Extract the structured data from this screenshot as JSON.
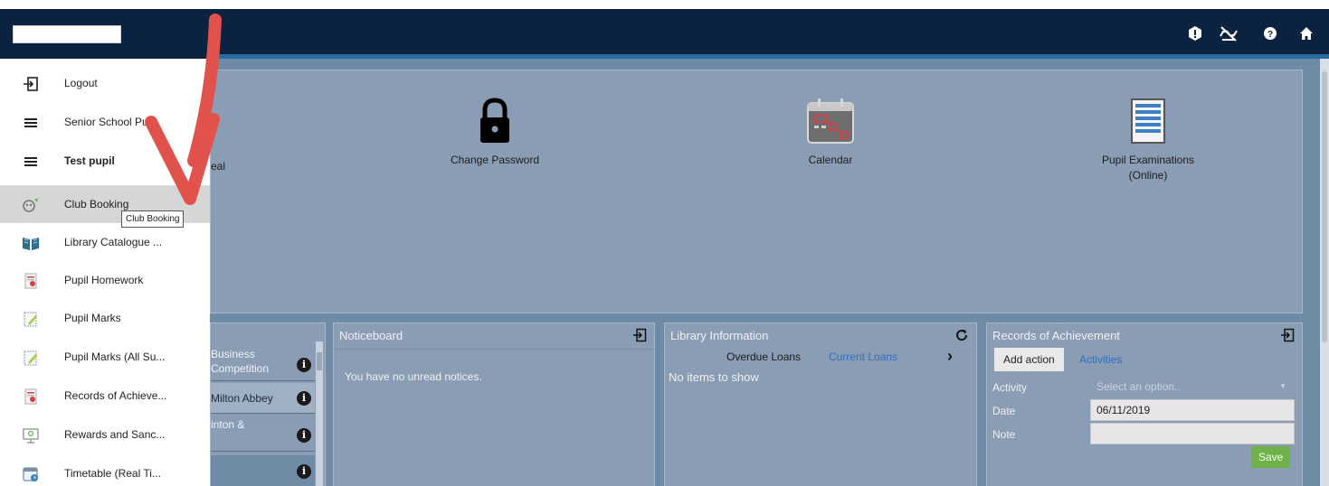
{
  "topbar": {
    "icons": [
      "alert-icon",
      "no-connection-icon",
      "help-icon",
      "home-icon"
    ]
  },
  "sidebar": {
    "items": [
      {
        "label": "Logout",
        "icon": "logout-icon"
      },
      {
        "label": "Senior School Pu",
        "icon": "hamburger-icon"
      },
      {
        "label": "Test pupil",
        "icon": "hamburger-icon"
      },
      {
        "label": "Club Booking",
        "icon": "club-icon"
      },
      {
        "label": "Library Catalogue ...",
        "icon": "book-icon"
      },
      {
        "label": "Pupil Homework",
        "icon": "homework-icon"
      },
      {
        "label": "Pupil Marks",
        "icon": "marks-icon"
      },
      {
        "label": "Pupil Marks (All Su...",
        "icon": "marks-icon"
      },
      {
        "label": "Records of Achieve...",
        "icon": "records-icon"
      },
      {
        "label": "Rewards and Sanc...",
        "icon": "rewards-icon"
      },
      {
        "label": "Timetable (Real Ti...",
        "icon": "timetable-icon"
      }
    ],
    "active_index": 3,
    "tooltip": "Club Booking"
  },
  "tiles": {
    "partial_label": "eal",
    "change_password": "Change Password",
    "calendar": "Calendar",
    "exams_line1": "Pupil Examinations",
    "exams_line2": "(Online)"
  },
  "club_list": {
    "rows": [
      {
        "line1": "Business",
        "line2": "Competition"
      },
      {
        "line1": "Milton Abbey",
        "line2": ""
      },
      {
        "line1": "inton &",
        "line2": ""
      },
      {
        "line1": "",
        "line2": ""
      }
    ],
    "info_glyph": "i"
  },
  "noticeboard": {
    "title": "Noticeboard",
    "message": "You have no unread notices."
  },
  "library": {
    "title": "Library Information",
    "tab_overdue": "Overdue Loans",
    "tab_current": "Current Loans",
    "next": "›",
    "empty": "No items to show"
  },
  "achievement": {
    "title": "Records of Achievement",
    "add_action": "Add action",
    "activities": "Activities",
    "activity_label": "Activity",
    "activity_placeholder": "Select an option..",
    "date_label": "Date",
    "date_value": "06/11/2019",
    "note_label": "Note",
    "save": "Save"
  },
  "colors": {
    "topbar": "#0b2340",
    "panel": "#8a9db4",
    "accent_link": "#2f6ec2",
    "save_button": "#6fb24a",
    "annotation_arrow": "#e0524b"
  }
}
